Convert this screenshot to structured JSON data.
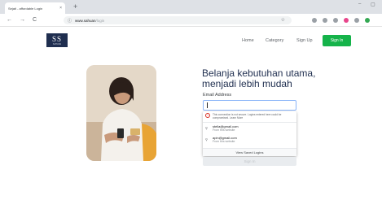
{
  "browser": {
    "tab_title": "Sejati - affordable Login",
    "tab_close": "×",
    "new_tab": "+",
    "minimize": "–",
    "maximize": "▢",
    "back": "←",
    "forward": "→",
    "reload": "C",
    "url_host": "www.sahuan",
    "url_path": "/login",
    "star": "☆"
  },
  "header": {
    "logo_mark": "SS",
    "logo_sub": "SAHUAN",
    "nav": [
      "Home",
      "Category",
      "Sign Up"
    ],
    "signin_label": "Sign In"
  },
  "form": {
    "headline_line1": "Belanja kebutuhan utama,",
    "headline_line2": "menjadi lebih mudah",
    "email_label": "Email Address",
    "email_value": "",
    "autofill_warning": "This connection is not secure. Logins entered here could be compromised. Learn More",
    "suggestions": [
      {
        "email": "stella@gmail.com",
        "source": "From this website"
      },
      {
        "email": "apin@gmail.com",
        "source": "From this website"
      }
    ],
    "view_saved": "View Saved Logins",
    "submit_label": "Sign In"
  },
  "colors": {
    "brand_navy": "#1f2e4f",
    "signin_green": "#15b34a"
  }
}
